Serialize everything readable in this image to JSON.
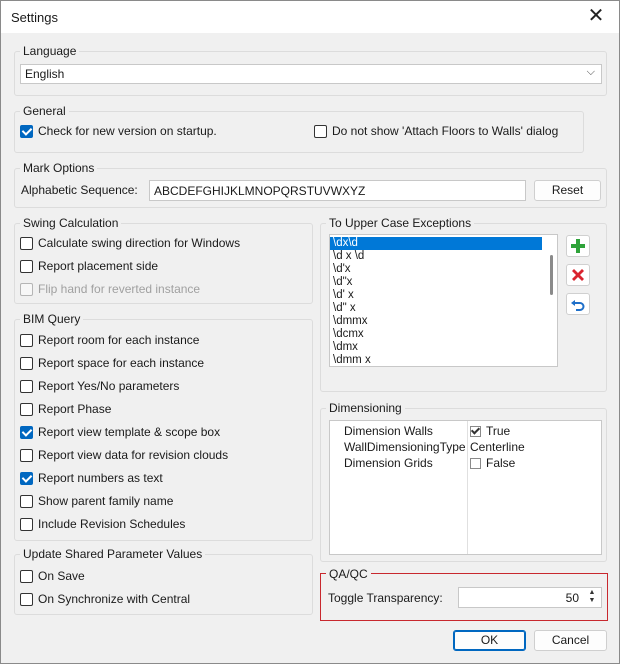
{
  "window": {
    "title": "Settings",
    "close_glyph": "✕"
  },
  "language": {
    "legend": "Language",
    "selected": "English",
    "chevron": "⌵"
  },
  "general": {
    "legend": "General",
    "check_version": {
      "label": "Check for new version on startup.",
      "checked": true
    },
    "no_attach_dialog": {
      "label": "Do not show 'Attach Floors to Walls' dialog",
      "checked": false
    }
  },
  "mark_options": {
    "legend": "Mark Options",
    "seq_label": "Alphabetic Sequence:",
    "seq_value": "ABCDEFGHIJKLMNOPQRSTUVWXYZ",
    "reset_label": "Reset"
  },
  "swing": {
    "legend": "Swing Calculation",
    "items": [
      {
        "label": "Calculate swing direction for Windows",
        "checked": false,
        "disabled": false
      },
      {
        "label": "Report placement side",
        "checked": false,
        "disabled": false
      },
      {
        "label": "Flip hand for reverted instance",
        "checked": false,
        "disabled": true
      }
    ]
  },
  "upper_case": {
    "legend": "To Upper Case Exceptions",
    "items": [
      "\\dx\\d",
      "\\d x \\d",
      "\\d'x",
      "\\d\"x",
      "\\d' x",
      "\\d\" x",
      "\\dmmx",
      "\\dcmx",
      "\\dmx",
      "\\dmm x"
    ],
    "selected_index": 0,
    "add_icon": "plus-icon",
    "remove_icon": "delete-icon",
    "undo_icon": "undo-icon"
  },
  "bim_query": {
    "legend": "BIM Query",
    "items": [
      {
        "label": "Report room for each instance",
        "checked": false
      },
      {
        "label": "Report space for each instance",
        "checked": false
      },
      {
        "label": "Report Yes/No parameters",
        "checked": false
      },
      {
        "label": "Report Phase",
        "checked": false
      },
      {
        "label": "Report view template & scope box",
        "checked": true
      },
      {
        "label": "Report view data for revision clouds",
        "checked": false
      },
      {
        "label": "Report numbers as text",
        "checked": true
      },
      {
        "label": "Show parent family name",
        "checked": false
      },
      {
        "label": "Include Revision Schedules",
        "checked": false
      }
    ]
  },
  "dimensioning": {
    "legend": "Dimensioning",
    "rows": [
      {
        "name": "Dimension Walls",
        "value": "True",
        "type": "bool",
        "checked": true
      },
      {
        "name": "WallDimensioningType",
        "value": "Centerline",
        "type": "text",
        "checked": false
      },
      {
        "name": "Dimension Grids",
        "value": "False",
        "type": "bool",
        "checked": false
      }
    ]
  },
  "shared_params": {
    "legend": "Update Shared Parameter Values",
    "items": [
      {
        "label": "On Save",
        "checked": false
      },
      {
        "label": "On Synchronize with Central",
        "checked": false
      }
    ]
  },
  "qaqc": {
    "legend": "QA/QC",
    "toggle_label": "Toggle Transparency:",
    "transparency_value": "50",
    "highlight_color": "#c8282e"
  },
  "footer": {
    "ok_label": "OK",
    "cancel_label": "Cancel"
  }
}
